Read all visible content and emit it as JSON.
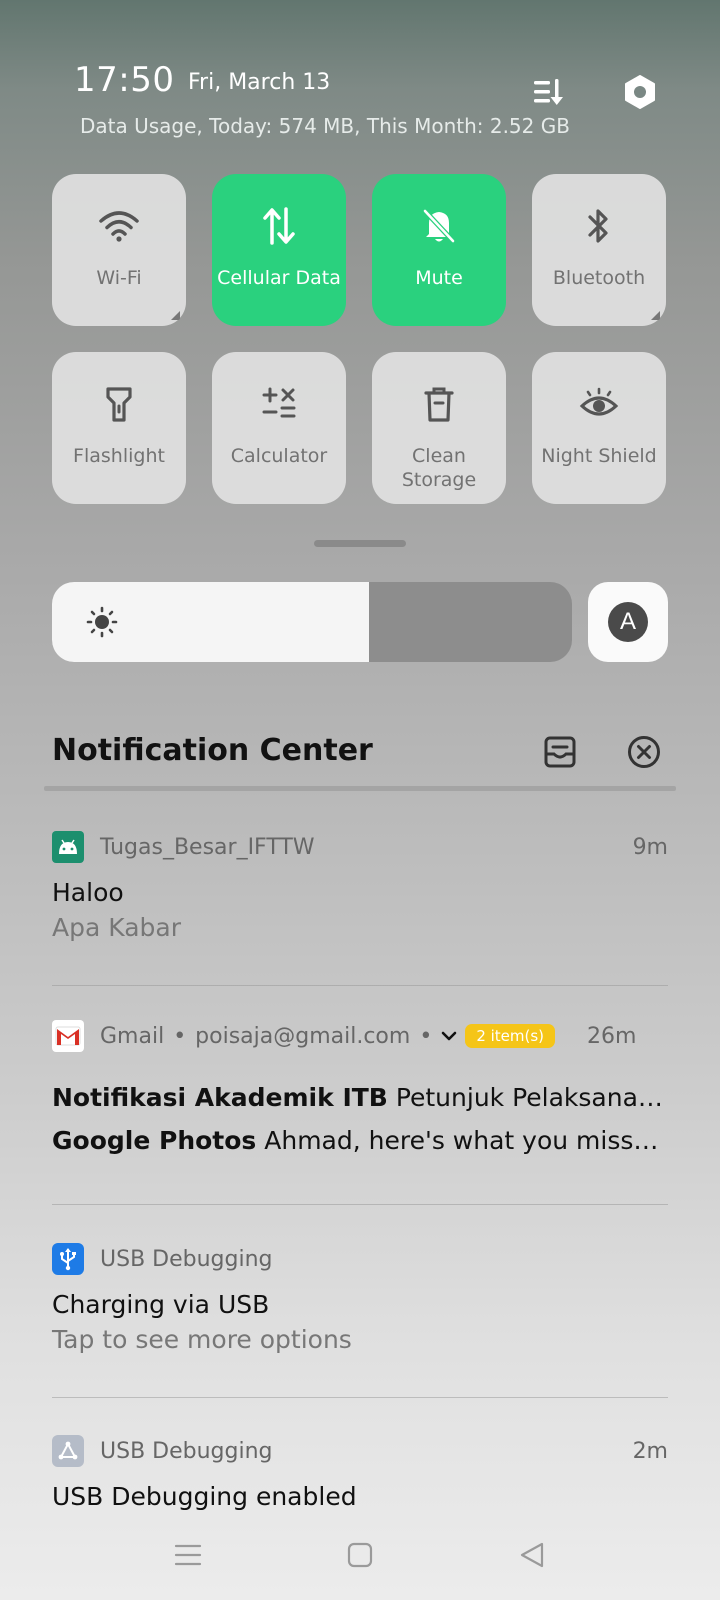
{
  "status": {
    "time": "17:50",
    "date": "Fri, March 13",
    "data_usage": "Data Usage, Today: 574 MB, This Month: 2.52 GB"
  },
  "quick_tiles": [
    {
      "label": "Wi-Fi",
      "icon": "wifi-icon",
      "active": false
    },
    {
      "label": "Cellular Data",
      "icon": "cellular-data-icon",
      "active": true
    },
    {
      "label": "Mute",
      "icon": "bell-off-icon",
      "active": true
    },
    {
      "label": "Bluetooth",
      "icon": "bluetooth-icon",
      "active": false
    },
    {
      "label": "Flashlight",
      "icon": "flashlight-icon",
      "active": false
    },
    {
      "label": "Calculator",
      "icon": "calculator-icon",
      "active": false
    },
    {
      "label": "Clean Storage",
      "icon": "trash-icon",
      "active": false
    },
    {
      "label": "Night Shield",
      "icon": "eye-icon",
      "active": false
    }
  ],
  "brightness": {
    "level": 0.61,
    "auto_label": "A"
  },
  "notification_center": {
    "title": "Notification Center"
  },
  "notifications": {
    "n1": {
      "app": "Tugas_Besar_IFTTW",
      "time": "9m",
      "title": "Haloo",
      "body": "Apa Kabar"
    },
    "gmail": {
      "app": "Gmail",
      "account": "poisaja@gmail.com",
      "badge": "2 item(s)",
      "time": "26m",
      "items": [
        {
          "sender": "Notifikasi Akademik ITB",
          "snippet": "Petunjuk Pelaksanaan Kegiatan..."
        },
        {
          "sender": "Google Photos",
          "snippet": "Ahmad, here's what you missed..."
        }
      ]
    },
    "usb1": {
      "app": "USB Debugging",
      "title": "Charging via USB",
      "body": "Tap to see more options"
    },
    "usb2": {
      "app": "USB Debugging",
      "time": "2m",
      "title": "USB Debugging enabled"
    }
  },
  "colors": {
    "active_tile": "#2ad17e",
    "badge": "#f5c518",
    "usb_blue": "#1e7be6"
  }
}
